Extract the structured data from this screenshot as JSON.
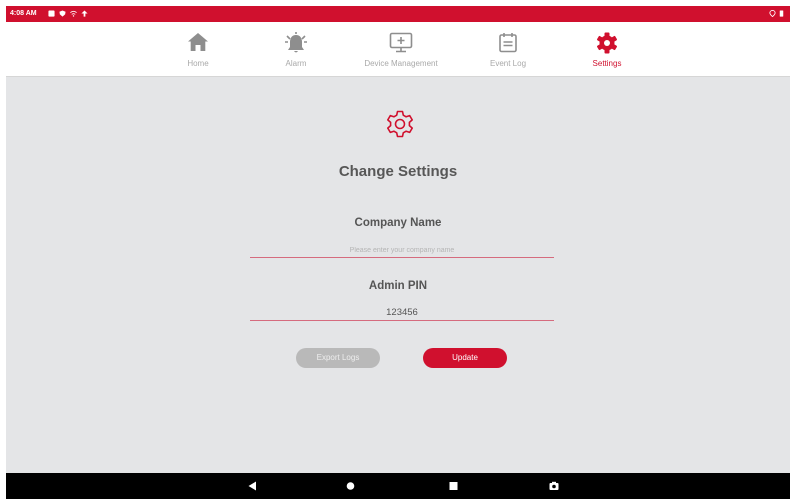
{
  "status_bar": {
    "time": "4:08 AM",
    "color": "#d0102e"
  },
  "nav": {
    "items": [
      {
        "label": "Home",
        "icon": "home-icon"
      },
      {
        "label": "Alarm",
        "icon": "alarm-icon"
      },
      {
        "label": "Device Management",
        "icon": "device-management-icon"
      },
      {
        "label": "Event Log",
        "icon": "event-log-icon"
      },
      {
        "label": "Settings",
        "icon": "gear-icon",
        "active": true
      }
    ],
    "active_color": "#d0102e",
    "inactive_color": "#a9a9a9"
  },
  "main": {
    "title": "Change Settings",
    "company_label": "Company Name",
    "company_value": "",
    "company_placeholder": "Please enter your company name",
    "pin_label": "Admin PIN",
    "pin_value": "123456",
    "export_label": "Export Logs",
    "update_label": "Update"
  },
  "system_nav": [
    "back-icon",
    "home-circle-icon",
    "recents-icon",
    "screenshot-icon"
  ]
}
